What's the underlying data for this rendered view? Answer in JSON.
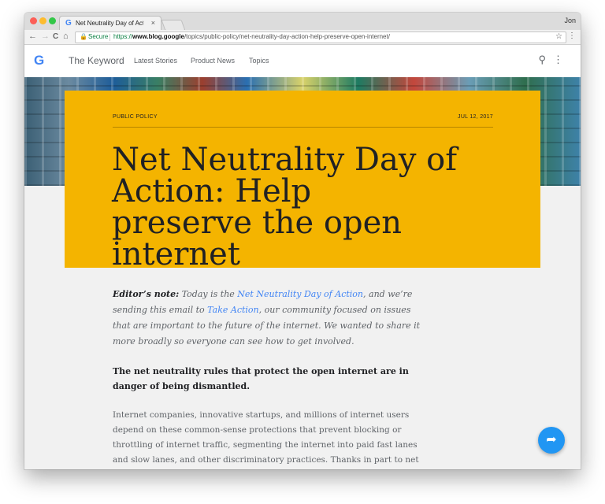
{
  "browser": {
    "tab_title": "Net Neutrality Day of Action: H",
    "tab_favicon": "G",
    "tab_close": "×",
    "user_name": "Jon",
    "secure_label": "Secure",
    "url_scheme": "https://",
    "url_host": "www.blog.google",
    "url_path": "/topics/public-policy/net-neutrality-day-action-help-preserve-open-internet/",
    "icons": {
      "back": "←",
      "forward": "→",
      "reload": "C",
      "home": "⌂",
      "lock": "🔒",
      "bookmark": "☆",
      "menu": "⋮"
    }
  },
  "site": {
    "logo": "G",
    "brand": "The Keyword",
    "nav": [
      "Latest Stories",
      "Product News",
      "Topics"
    ],
    "search_icon": "⚲",
    "more_icon": "⋮"
  },
  "article": {
    "category": "PUBLIC POLICY",
    "date": "JUL 12, 2017",
    "headline": "Net Neutrality Day of Action: Help preserve the open internet",
    "editor_label": "Editor’s note:",
    "editor_part1": " Today is the ",
    "editor_link1": "Net Neutrality Day of Action",
    "editor_part2": ", and we’re sending this email to ",
    "editor_link2": "Take Action",
    "editor_part3": ", our community focused on issues that are important to the future of the internet. We wanted to share it more broadly so everyone can see how to get involved.",
    "lead": "The net neutrality rules that protect the open internet are in danger of being dismantled.",
    "body": "Internet companies, innovative startups, and millions of internet users depend on these common-sense protections that prevent blocking or throttling of internet traffic, segmenting the internet into paid fast lanes and slow lanes, and other discriminatory practices. Thanks in part to net neutrality, the open internet has grown to become an unrivaled source of choice, competition, innovation, free"
  },
  "share_icon": "➦",
  "colors": {
    "card": "#f4b400",
    "link": "#4285f4",
    "share": "#2196f3"
  }
}
